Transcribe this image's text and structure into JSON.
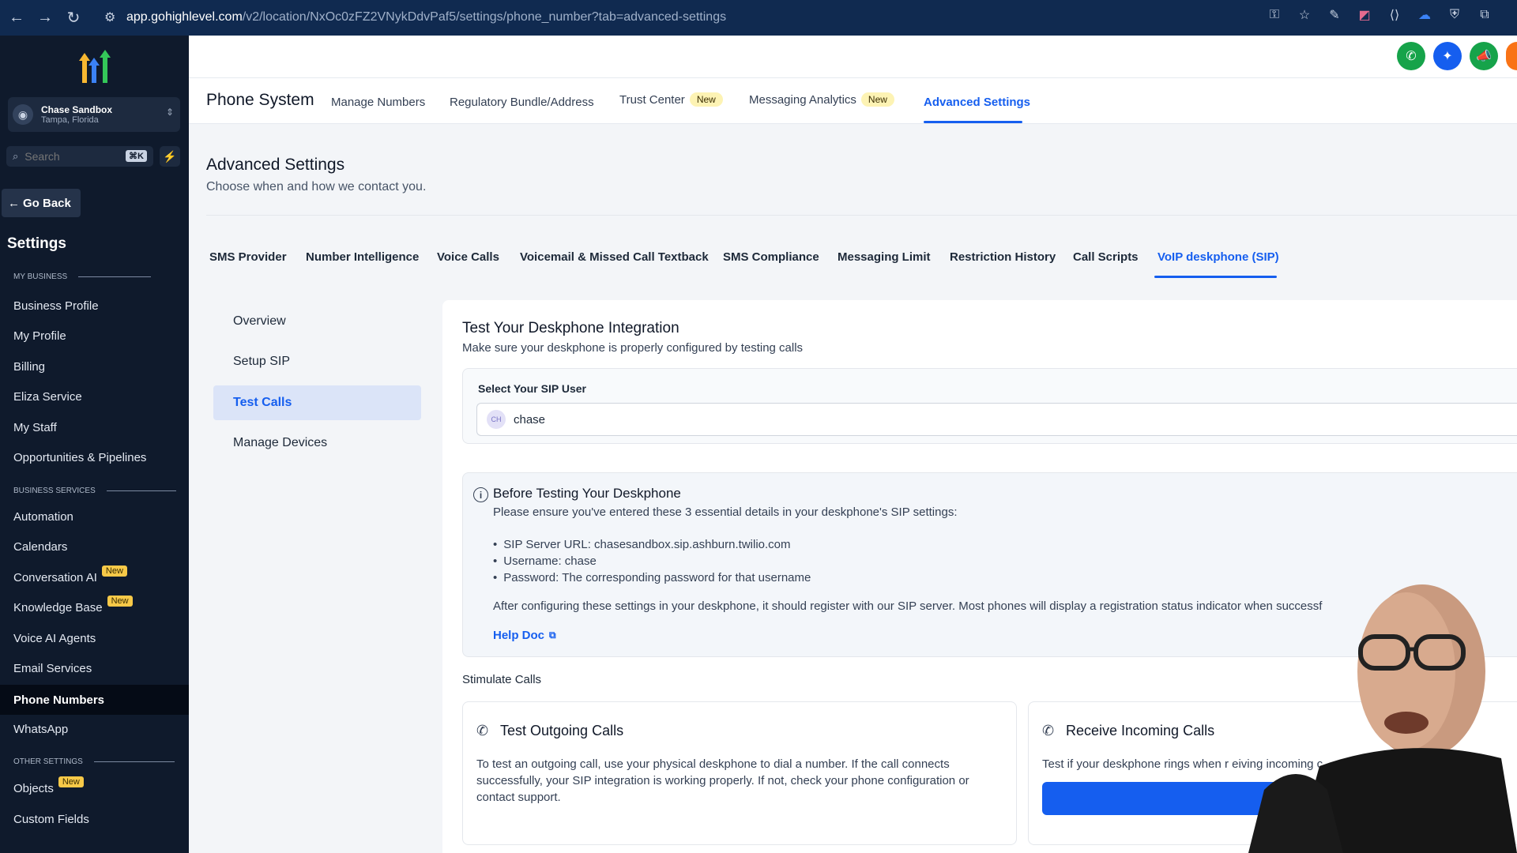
{
  "browser": {
    "url_domain": "app.gohighlevel.com",
    "url_path": "/v2/location/NxOc0zFZ2VNykDdvPaf5/settings/phone_number?tab=advanced-settings"
  },
  "sidebar": {
    "account_name": "Chase Sandbox",
    "account_location": "Tampa, Florida",
    "search_placeholder": "Search",
    "search_shortcut": "⌘K",
    "go_back": "Go Back",
    "settings_title": "Settings",
    "sections": {
      "my_business": "MY BUSINESS",
      "business_services": "BUSINESS SERVICES",
      "other_settings": "OTHER SETTINGS"
    },
    "items": [
      {
        "label": "Business Profile"
      },
      {
        "label": "My Profile"
      },
      {
        "label": "Billing"
      },
      {
        "label": "Eliza Service"
      },
      {
        "label": "My Staff"
      },
      {
        "label": "Opportunities & Pipelines"
      },
      {
        "label": "Automation"
      },
      {
        "label": "Calendars"
      },
      {
        "label": "Conversation AI",
        "badge": "New"
      },
      {
        "label": "Knowledge Base",
        "badge": "New"
      },
      {
        "label": "Voice AI Agents"
      },
      {
        "label": "Email Services"
      },
      {
        "label": "Phone Numbers",
        "active": true
      },
      {
        "label": "WhatsApp"
      },
      {
        "label": "Objects",
        "badge": "New"
      },
      {
        "label": "Custom Fields"
      }
    ]
  },
  "header": {
    "page_title": "Phone System",
    "tabs": [
      {
        "label": "Manage Numbers"
      },
      {
        "label": "Regulatory Bundle/Address"
      },
      {
        "label": "Trust Center",
        "badge": "New"
      },
      {
        "label": "Messaging Analytics",
        "badge": "New"
      },
      {
        "label": "Advanced Settings",
        "active": true
      }
    ]
  },
  "advanced": {
    "title": "Advanced Settings",
    "subtitle": "Choose when and how we contact you.",
    "sub_tabs": [
      {
        "label": "SMS Provider"
      },
      {
        "label": "Number Intelligence"
      },
      {
        "label": "Voice Calls"
      },
      {
        "label": "Voicemail & Missed Call Textback"
      },
      {
        "label": "SMS Compliance"
      },
      {
        "label": "Messaging Limit"
      },
      {
        "label": "Restriction History"
      },
      {
        "label": "Call Scripts"
      },
      {
        "label": "VoIP deskphone (SIP)",
        "active": true
      }
    ],
    "side_menu": [
      {
        "label": "Overview"
      },
      {
        "label": "Setup SIP"
      },
      {
        "label": "Test Calls",
        "active": true
      },
      {
        "label": "Manage Devices"
      }
    ]
  },
  "content": {
    "title": "Test Your Deskphone Integration",
    "subtitle": "Make sure your deskphone is properly configured by testing calls",
    "sip_label": "Select Your SIP User",
    "sip_avatar": "CH",
    "sip_value": "chase",
    "info_title": "Before Testing Your Deskphone",
    "info_sub": "Please ensure you've entered these 3 essential details in your deskphone's SIP settings:",
    "info_items": [
      "SIP Server URL: chasesandbox.sip.ashburn.twilio.com",
      "Username: chase",
      "Password: The corresponding password for that username"
    ],
    "info_after": "After configuring these settings in your deskphone, it should register with our SIP server. Most phones will display a registration status indicator when successf",
    "help_link": "Help Doc",
    "stimulate_label": "Stimulate Calls",
    "outgoing_title": "Test Outgoing Calls",
    "outgoing_text": "To test an outgoing call, use your physical deskphone to dial a number. If the call connects successfully, your SIP integration is working properly. If not, check your phone configuration or contact support.",
    "incoming_title": "Receive Incoming Calls",
    "incoming_text": "Test if your deskphone rings when r eiving incoming c"
  },
  "colors": {
    "accent": "#155eef",
    "sidebar_bg": "#0f1a2c",
    "badge_yellow": "#f7c948"
  }
}
